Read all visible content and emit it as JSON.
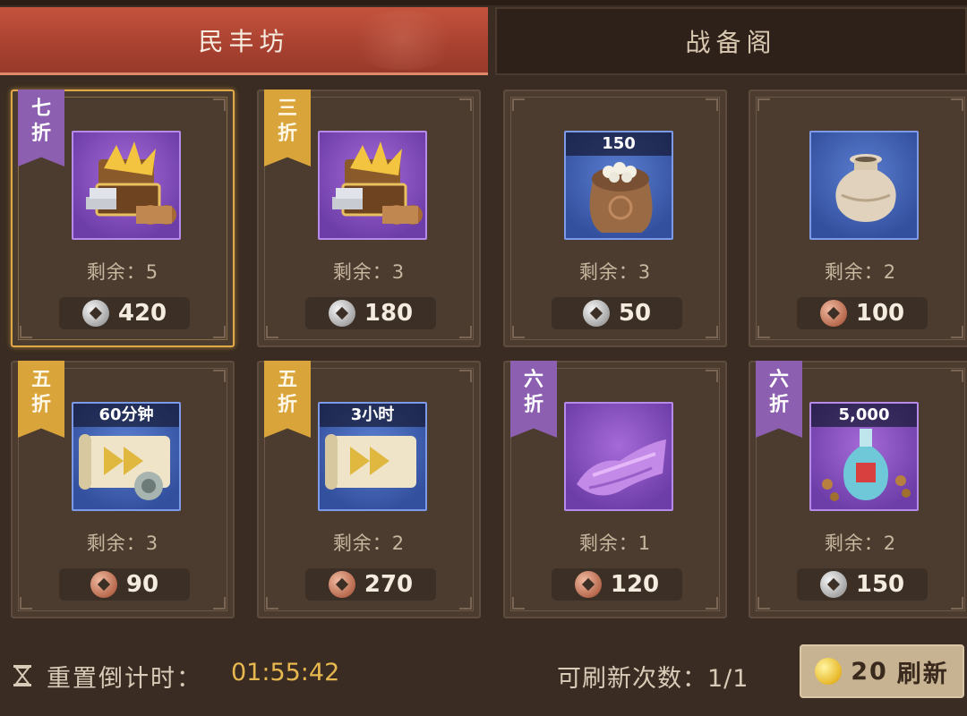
{
  "tabs": [
    {
      "label": "民丰坊",
      "active": true
    },
    {
      "label": "战备阁",
      "active": false
    }
  ],
  "items": [
    {
      "discount_1": "七",
      "discount_2": "折",
      "ribbon_color": "purple",
      "icon": "treasure-chest-icon",
      "rarity": "purple",
      "quantity": "",
      "remaining": "剩余：5",
      "currency": "silver-coin-icon",
      "price": "420",
      "selected": true
    },
    {
      "discount_1": "三",
      "discount_2": "折",
      "ribbon_color": "gold",
      "icon": "treasure-chest-icon",
      "rarity": "purple",
      "quantity": "",
      "remaining": "剩余：3",
      "currency": "silver-coin-icon",
      "price": "180",
      "selected": false
    },
    {
      "discount_1": "",
      "discount_2": "",
      "ribbon_color": "",
      "icon": "grain-sack-icon",
      "rarity": "blue",
      "quantity": "150",
      "remaining": "剩余：3",
      "currency": "silver-coin-icon",
      "price": "50",
      "selected": false
    },
    {
      "discount_1": "",
      "discount_2": "",
      "ribbon_color": "",
      "icon": "ceramic-jar-icon",
      "rarity": "blue",
      "quantity": "",
      "remaining": "剩余：2",
      "currency": "copper-coin-icon",
      "price": "100",
      "selected": false
    },
    {
      "discount_1": "五",
      "discount_2": "折",
      "ribbon_color": "gold",
      "icon": "speedup-scroll-icon",
      "rarity": "blue",
      "quantity": "60分钟",
      "remaining": "剩余：3",
      "currency": "copper-coin-icon",
      "price": "90",
      "selected": false
    },
    {
      "discount_1": "五",
      "discount_2": "折",
      "ribbon_color": "gold",
      "icon": "speedup-scroll-icon",
      "rarity": "blue",
      "quantity": "3小时",
      "remaining": "剩余：2",
      "currency": "copper-coin-icon",
      "price": "270",
      "selected": false
    },
    {
      "discount_1": "六",
      "discount_2": "折",
      "ribbon_color": "purple",
      "icon": "purple-cloth-icon",
      "rarity": "purple",
      "quantity": "",
      "remaining": "剩余：1",
      "currency": "copper-coin-icon",
      "price": "120",
      "selected": false
    },
    {
      "discount_1": "六",
      "discount_2": "折",
      "ribbon_color": "purple",
      "icon": "potion-vase-icon",
      "rarity": "purple",
      "quantity": "5,000",
      "remaining": "剩余：2",
      "currency": "silver-coin-icon",
      "price": "150",
      "selected": false
    }
  ],
  "footer": {
    "reset_label": "重置倒计时：",
    "reset_time": "01:55:42",
    "refresh_count": "可刷新次数：1/1",
    "refresh_cost": "20",
    "refresh_label": "刷新"
  },
  "colors": {
    "active_tab": "#b0452f",
    "purple_ribbon": "#8c5fb0",
    "gold_ribbon": "#d9a43a",
    "timer": "#e8b850"
  }
}
